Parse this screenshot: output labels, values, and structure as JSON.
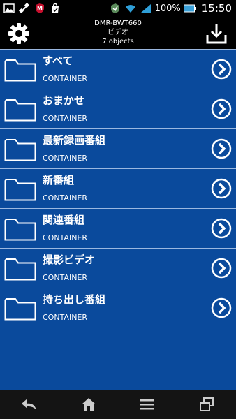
{
  "status": {
    "battery_text": "100%",
    "time": "15:50",
    "icons": [
      "image-icon",
      "satellite-icon",
      "mcafee-icon",
      "shopping-bag-icon",
      "nfc-icon",
      "wifi-icon",
      "signal-icon",
      "battery-icon"
    ]
  },
  "header": {
    "device": "DMR-BWT660",
    "folder": "ビデオ",
    "count": "7 objects",
    "settings_icon": "gear-icon",
    "download_icon": "download-icon"
  },
  "list": {
    "items": [
      {
        "title": "すべて",
        "type": "CONTAINER"
      },
      {
        "title": "おまかせ",
        "type": "CONTAINER"
      },
      {
        "title": "最新録画番組",
        "type": "CONTAINER"
      },
      {
        "title": "新番組",
        "type": "CONTAINER"
      },
      {
        "title": "関連番組",
        "type": "CONTAINER"
      },
      {
        "title": "撮影ビデオ",
        "type": "CONTAINER"
      },
      {
        "title": "持ち出し番組",
        "type": "CONTAINER"
      }
    ]
  },
  "nav": {
    "icons": [
      "back-icon",
      "home-icon",
      "menu-icon",
      "recent-apps-icon"
    ]
  },
  "colors": {
    "list_bg": "#0a4a9c",
    "divider": "#9bb8e0"
  }
}
